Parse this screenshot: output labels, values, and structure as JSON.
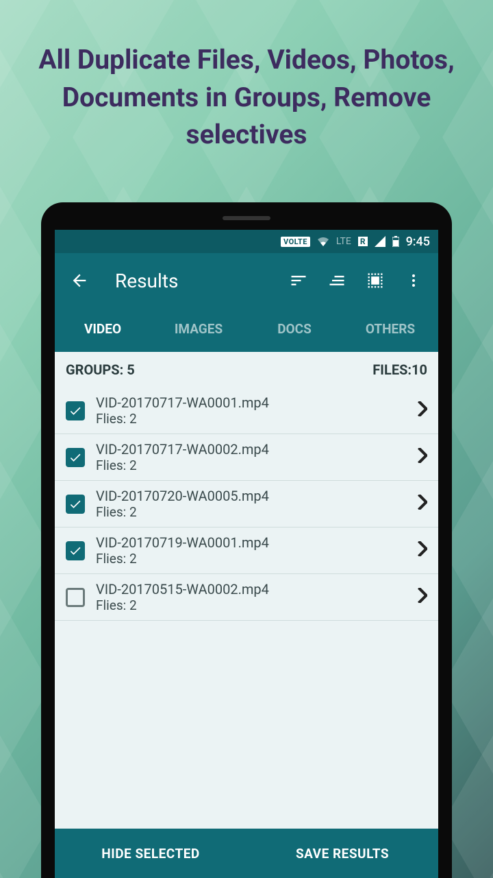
{
  "promo": {
    "title": "All Duplicate Files, Videos, Photos, Documents in Groups, Remove selectives"
  },
  "statusBar": {
    "volte": "VOLTE",
    "lte": "LTE",
    "r": "R",
    "time": "9:45"
  },
  "appBar": {
    "title": "Results"
  },
  "tabs": {
    "items": [
      {
        "label": "VIDEO",
        "active": true
      },
      {
        "label": "IMAGES",
        "active": false
      },
      {
        "label": "DOCS",
        "active": false
      },
      {
        "label": "OTHERS",
        "active": false
      }
    ]
  },
  "summary": {
    "groups": "GROUPS: 5",
    "files": "FILES:10"
  },
  "list": {
    "items": [
      {
        "title": "VID-20170717-WA0001.mp4",
        "sub": "Flies: 2",
        "checked": true
      },
      {
        "title": "VID-20170717-WA0002.mp4",
        "sub": "Flies: 2",
        "checked": true
      },
      {
        "title": "VID-20170720-WA0005.mp4",
        "sub": "Flies: 2",
        "checked": true
      },
      {
        "title": "VID-20170719-WA0001.mp4",
        "sub": "Flies: 2",
        "checked": true
      },
      {
        "title": "VID-20170515-WA0002.mp4",
        "sub": "Flies: 2",
        "checked": false
      }
    ]
  },
  "bottom": {
    "hide": "HIDE SELECTED",
    "save": "SAVE RESULTS"
  }
}
